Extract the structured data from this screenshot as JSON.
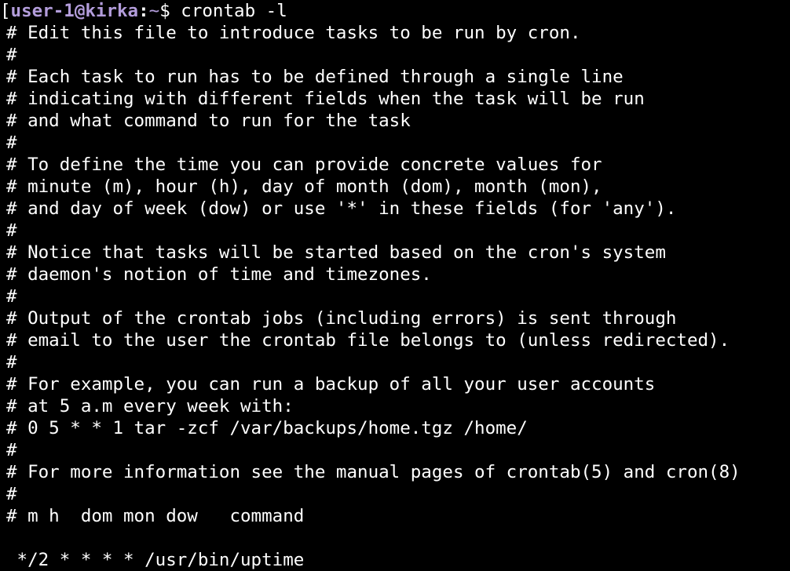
{
  "prompt": {
    "bracket": "[",
    "user_host": "user-1@kirka",
    "colon": ":",
    "path": "~",
    "dollar": "$ ",
    "command": "crontab -l"
  },
  "output_lines": [
    "# Edit this file to introduce tasks to be run by cron.",
    "#",
    "# Each task to run has to be defined through a single line",
    "# indicating with different fields when the task will be run",
    "# and what command to run for the task",
    "#",
    "# To define the time you can provide concrete values for",
    "# minute (m), hour (h), day of month (dom), month (mon),",
    "# and day of week (dow) or use '*' in these fields (for 'any').",
    "#",
    "# Notice that tasks will be started based on the cron's system",
    "# daemon's notion of time and timezones.",
    "#",
    "# Output of the crontab jobs (including errors) is sent through",
    "# email to the user the crontab file belongs to (unless redirected).",
    "#",
    "# For example, you can run a backup of all your user accounts",
    "# at 5 a.m every week with:",
    "# 0 5 * * 1 tar -zcf /var/backups/home.tgz /home/",
    "#",
    "# For more information see the manual pages of crontab(5) and cron(8)",
    "#",
    "# m h  dom mon dow   command",
    "",
    " */2 * * * * /usr/bin/uptime"
  ]
}
